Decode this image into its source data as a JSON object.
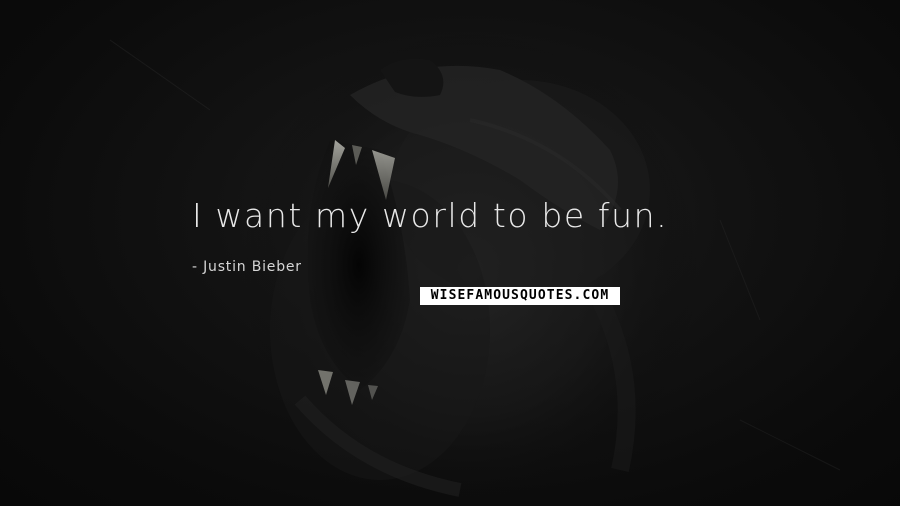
{
  "quote": {
    "text": "I want my world to be fun.",
    "author": "- Justin Bieber"
  },
  "brand": {
    "watermark": "WISEFAMOUSQUOTES.COM"
  },
  "background": {
    "icon": "roaring-lion-image",
    "base_color": "#0b0b0b",
    "text_color": "#e8e8e8"
  }
}
